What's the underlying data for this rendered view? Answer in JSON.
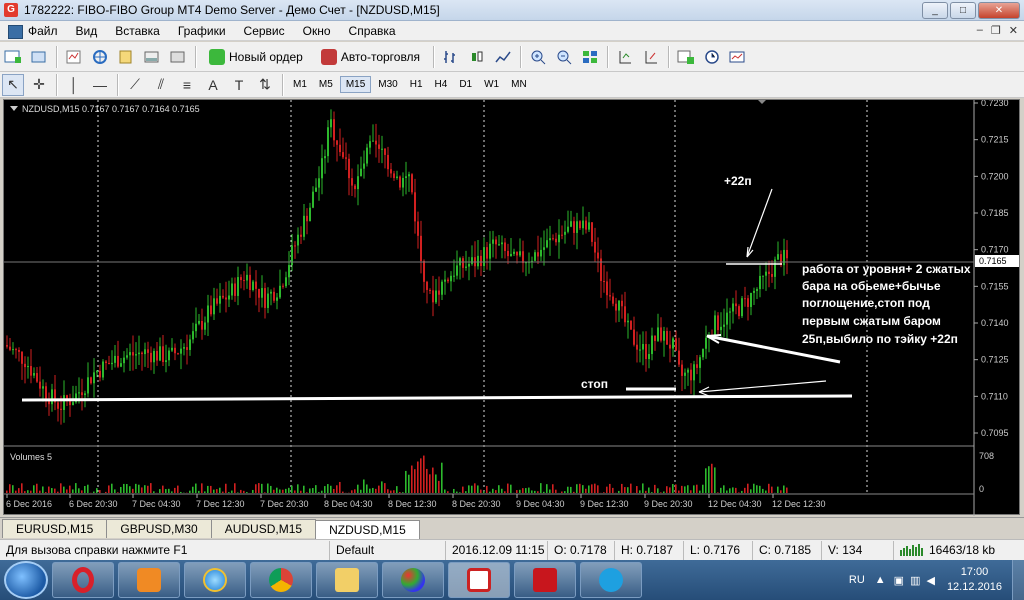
{
  "window": {
    "title": "1782222: FIBO-FIBO Group MT4 Demo Server - Демо Счет - [NZDUSD,M15]"
  },
  "menu": [
    "Файл",
    "Вид",
    "Вставка",
    "Графики",
    "Сервис",
    "Окно",
    "Справка"
  ],
  "toolbar": {
    "new_order": "Новый ордер",
    "auto_trading": "Авто-торговля"
  },
  "timeframes": [
    "M1",
    "M5",
    "M15",
    "M30",
    "H1",
    "H4",
    "D1",
    "W1",
    "MN"
  ],
  "active_timeframe": "M15",
  "chart": {
    "header": "NZDUSD,M15  0.7167 0.7167 0.7164 0.7165",
    "volumes_label": "Volumes 5",
    "price_labels": [
      "0.7230",
      "0.7215",
      "0.7200",
      "0.7185",
      "0.7170",
      "0.7165",
      "0.7155",
      "0.7140",
      "0.7125",
      "0.7110",
      "0.7095"
    ],
    "current_price": "0.7165",
    "volume_labels": [
      "708",
      "0"
    ],
    "time_labels": [
      "6 Dec 2016",
      "6 Dec 20:30",
      "7 Dec 04:30",
      "7 Dec 12:30",
      "7 Dec 20:30",
      "8 Dec 04:30",
      "8 Dec 12:30",
      "8 Dec 20:30",
      "9 Dec 04:30",
      "9 Dec 12:30",
      "9 Dec 20:30",
      "12 Dec 04:30",
      "12 Dec 12:30"
    ],
    "annotations": {
      "profit": "+22п",
      "stop": "стоп",
      "note": [
        "работа от уровня+ 2 сжатых",
        "бара на обьеме+бычье",
        "поглощение,стоп под",
        "первым сжатым баром",
        "25п,выбило по тэйку +22п"
      ]
    },
    "colors": {
      "bull": "#2db92d",
      "bear": "#d22020",
      "background": "#000000",
      "text": "#ffffff"
    }
  },
  "tabs": [
    "EURUSD,M15",
    "GBPUSD,M30",
    "AUDUSD,M15",
    "NZDUSD,M15"
  ],
  "active_tab": "NZDUSD,M15",
  "status": {
    "help": "Для вызова справки нажмите F1",
    "profile": "Default",
    "time": "2016.12.09 11:15",
    "open": "O: 0.7178",
    "high": "H: 0.7187",
    "low": "L: 0.7176",
    "close": "C: 0.7185",
    "volume": "V: 134",
    "traffic": "16463/18 kb"
  },
  "taskbar": {
    "lang": "RU",
    "time": "17:00",
    "date": "12.12.2016"
  }
}
